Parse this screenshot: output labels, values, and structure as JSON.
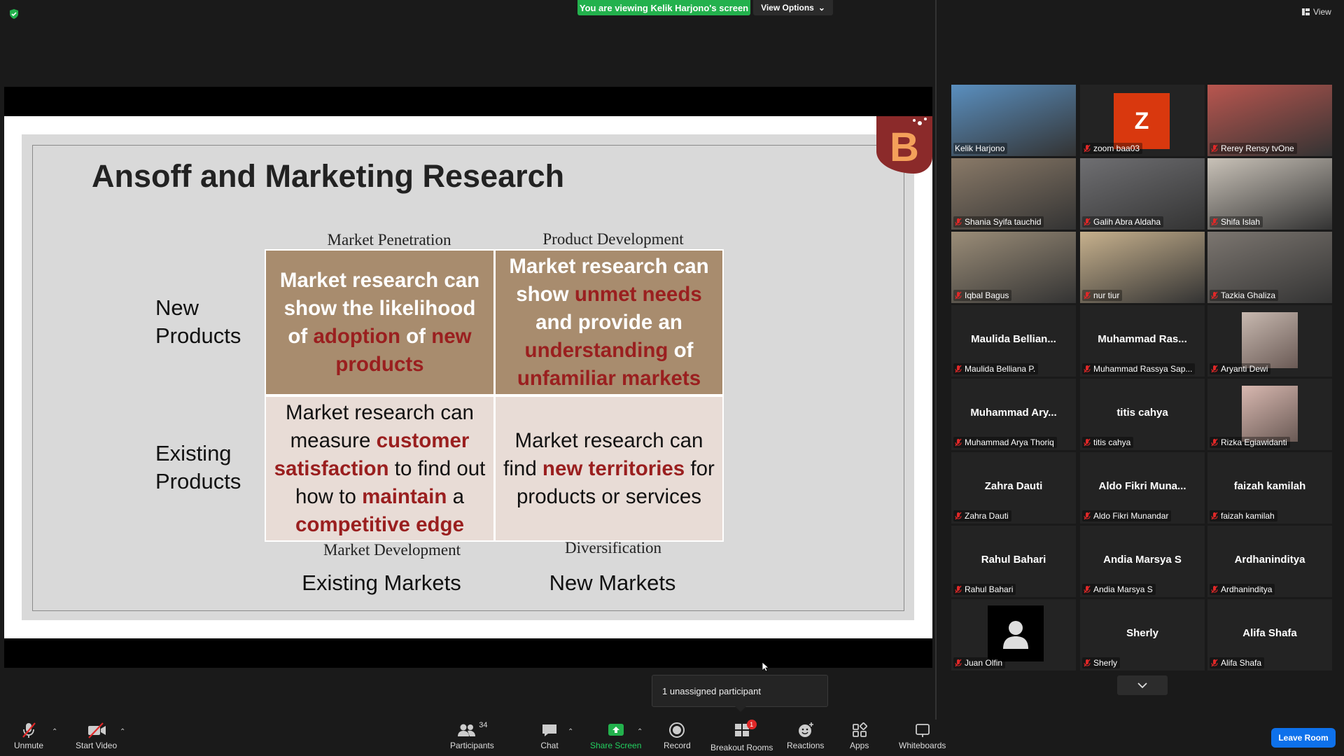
{
  "banner": {
    "viewing_text": "You are viewing Kelik Harjono's screen",
    "view_options_label": "View Options",
    "view_label": "View"
  },
  "slide": {
    "title": "Ansoff and Marketing Research",
    "headers": {
      "top_left": "Market Penetration",
      "top_right": "Product Development",
      "bottom_left": "Market Development",
      "bottom_right": "Diversification"
    },
    "row_labels": {
      "new_line1": "New",
      "new_line2": "Products",
      "existing_line1": "Existing",
      "existing_line2": "Products"
    },
    "column_labels": {
      "existing": "Existing Markets",
      "new": "New Markets"
    },
    "cells": {
      "tl": {
        "p1": "Market research can show the likelihood of ",
        "h1": "adoption",
        "p2": " of ",
        "h2": "new products",
        "p3": ""
      },
      "tr": {
        "p1": "Market research can show ",
        "h1": "unmet needs",
        "p2": " and provide an ",
        "h2": "understanding",
        "p3": " of ",
        "h3": "unfamiliar markets"
      },
      "bl": {
        "p1": "Market research can measure ",
        "h1": "customer satisfaction",
        "p2": " to find out how to ",
        "h2": "maintain",
        "p3": " a ",
        "h3": "competitive edge"
      },
      "br": {
        "p1": "Market research can find ",
        "h1": "new territories",
        "p2": " for products or services"
      }
    }
  },
  "gallery": {
    "tiles": [
      {
        "name": "Kelik Harjono",
        "big": "",
        "video": true,
        "color": "#5a8fbf",
        "active": true
      },
      {
        "name": "zoom baa03",
        "big": "",
        "video": false,
        "avatar_letter": "Z",
        "avatar_color": "#d9380e"
      },
      {
        "name": "Rerey Rensy tvOne",
        "big": "",
        "video": true,
        "color": "#b9564f"
      },
      {
        "name": "Shania Syifa tauchid",
        "big": "",
        "video": true,
        "color": "#8a7a68"
      },
      {
        "name": "Galih Abra Aldaha",
        "big": "",
        "video": true,
        "color": "#6f6f72"
      },
      {
        "name": "Shifa Islah",
        "big": "",
        "video": true,
        "color": "#c9c2b8"
      },
      {
        "name": "Iqbal Bagus",
        "big": "",
        "video": true,
        "color": "#9b8d78"
      },
      {
        "name": "nur tiur",
        "big": "",
        "video": true,
        "color": "#c7b18d"
      },
      {
        "name": "Tazkia Ghaliza",
        "big": "",
        "video": true,
        "color": "#7c7670"
      },
      {
        "name": "Maulida Belliana P.",
        "big": "Maulida  Bellian...",
        "video": false
      },
      {
        "name": "Muhammad Rassya Sap...",
        "big": "Muhammad  Ras...",
        "video": false
      },
      {
        "name": "Aryanti Dewi",
        "big": "",
        "video": false,
        "photo_color": "#c8b9b0"
      },
      {
        "name": "Muhammad Arya Thoriq",
        "big": "Muhammad  Ary...",
        "video": false
      },
      {
        "name": "titis cahya",
        "big": "titis cahya",
        "video": false
      },
      {
        "name": "Rizka Egiawidanti",
        "big": "",
        "video": false,
        "photo_color": "#d8b8b0"
      },
      {
        "name": "Zahra Dauti",
        "big": "Zahra Dauti",
        "video": false
      },
      {
        "name": "Aldo Fikri Munandar",
        "big": "Aldo  Fikri  Muna...",
        "video": false
      },
      {
        "name": "faizah kamilah",
        "big": "faizah kamilah",
        "video": false
      },
      {
        "name": "Rahul Bahari",
        "big": "Rahul Bahari",
        "video": false
      },
      {
        "name": "Andia Marsya S",
        "big": "Andia Marsya S",
        "video": false
      },
      {
        "name": "Ardhaninditya",
        "big": "Ardhaninditya",
        "video": false
      },
      {
        "name": "Juan Olfin",
        "big": "",
        "video": false,
        "default_avatar": true
      },
      {
        "name": "Sherly",
        "big": "Sherly",
        "video": false
      },
      {
        "name": "Alifa Shafa",
        "big": "Alifa Shafa",
        "video": false
      }
    ]
  },
  "tooltip": {
    "text": "1 unassigned participant"
  },
  "toolbar": {
    "unmute": "Unmute",
    "start_video": "Start Video",
    "participants": "Participants",
    "participants_count": "34",
    "chat": "Chat",
    "share_screen": "Share Screen",
    "record": "Record",
    "breakout_rooms": "Breakout Rooms",
    "breakout_badge": "1",
    "reactions": "Reactions",
    "apps": "Apps",
    "whiteboards": "Whiteboards",
    "leave_room": "Leave Room"
  },
  "colors": {
    "accent_green": "#23b14d",
    "leave_blue": "#0e71eb",
    "highlight_red": "#9a1f1f",
    "active_outline": "#d4e23a"
  }
}
